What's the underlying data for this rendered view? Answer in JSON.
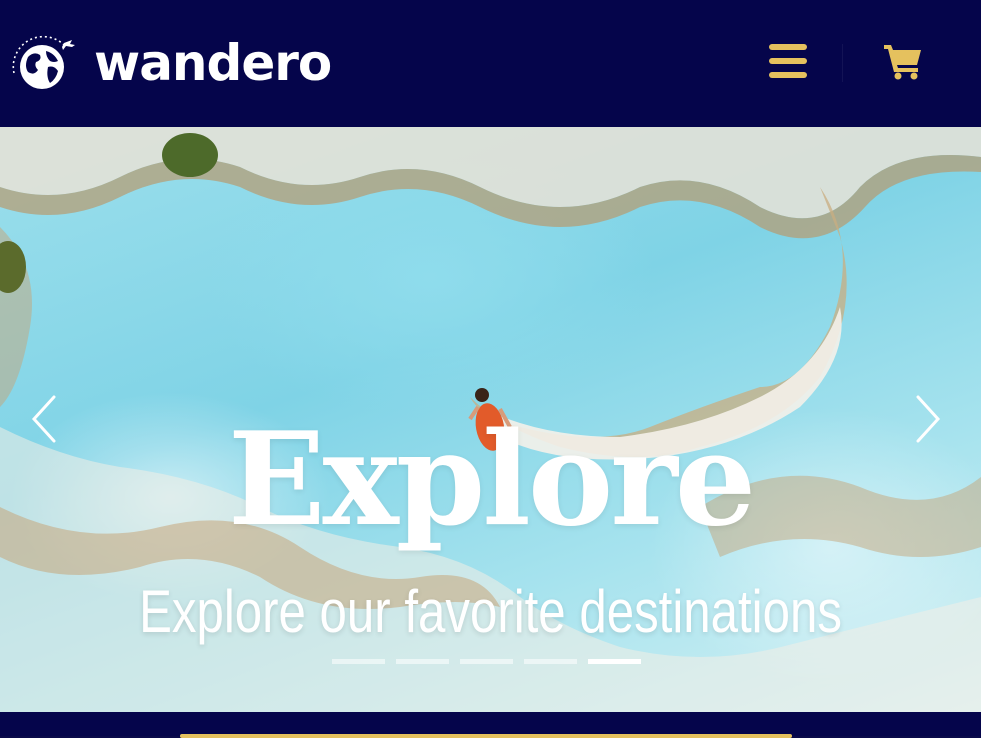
{
  "header": {
    "brand": "wandero",
    "menu_icon": "hamburger-icon",
    "cart_icon": "cart-icon",
    "accent_color": "#e5c15e",
    "background_color": "#05054b"
  },
  "hero": {
    "title": "Explore",
    "subtitle": "Explore our favorite destinations",
    "prev_icon": "chevron-left-icon",
    "next_icon": "chevron-right-icon",
    "slide_count": 5,
    "active_slide": 5
  }
}
